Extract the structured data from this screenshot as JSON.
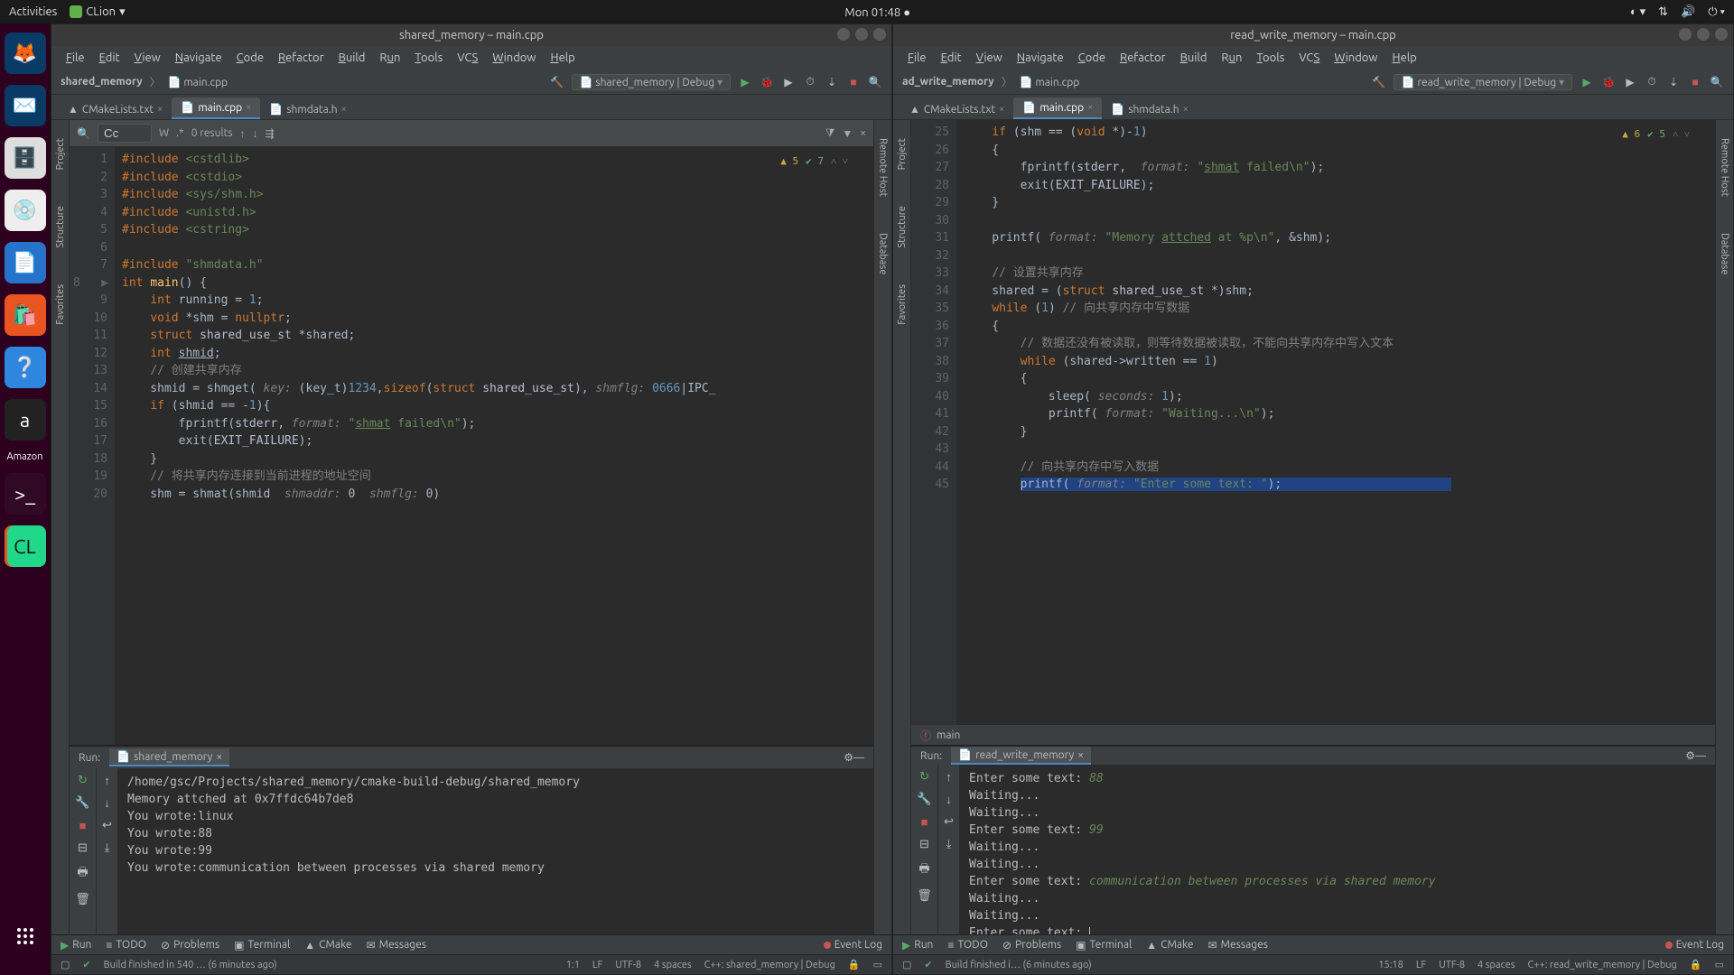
{
  "gnome": {
    "activities": "Activities",
    "app": "CLion",
    "clock": "Mon 01:48"
  },
  "dock": {
    "amazon_label": "Amazon"
  },
  "left_window": {
    "title": "shared_memory – main.cpp",
    "menus": [
      "File",
      "Edit",
      "View",
      "Navigate",
      "Code",
      "Refactor",
      "Build",
      "Run",
      "Tools",
      "VCS",
      "Window",
      "Help"
    ],
    "crumb_project": "shared_memory",
    "crumb_file": "main.cpp",
    "config": "shared_memory | Debug",
    "tabs": [
      {
        "name": "CMakeLists.txt",
        "active": false
      },
      {
        "name": "main.cpp",
        "active": true
      },
      {
        "name": "shmdata.h",
        "active": false
      }
    ],
    "find_results": "0 results",
    "hints": {
      "warn": "5",
      "check": "7"
    },
    "code_lines": [
      "1",
      "2",
      "3",
      "4",
      "5",
      "6",
      "7",
      "8",
      "9",
      "10",
      "11",
      "12",
      "13",
      "14",
      "15",
      "16",
      "17",
      "18",
      "19",
      "20"
    ],
    "run": {
      "label": "Run:",
      "config": "shared_memory",
      "output": [
        {
          "t": "/home/gsc/Projects/shared_memory/cmake-build-debug/shared_memory"
        },
        {
          "t": "Memory attched at 0x7ffdc64b7de8"
        },
        {
          "t": "You wrote:linux"
        },
        {
          "t": "You wrote:88"
        },
        {
          "t": "You wrote:99"
        },
        {
          "t": "You wrote:communication between processes via shared memory"
        }
      ]
    },
    "toolstrip": {
      "run": "Run",
      "todo": "TODO",
      "problems": "Problems",
      "terminal": "Terminal",
      "cmake": "CMake",
      "messages": "Messages",
      "eventlog": "Event Log"
    },
    "status": {
      "build": "Build finished in 540 … (6 minutes ago)",
      "pos": "1:1",
      "enc": "LF",
      "charset": "UTF-8",
      "indent": "4 spaces",
      "ctx": "C++: shared_memory | Debug"
    }
  },
  "right_window": {
    "title": "read_write_memory – main.cpp",
    "menus": [
      "File",
      "Edit",
      "View",
      "Navigate",
      "Code",
      "Refactor",
      "Build",
      "Run",
      "Tools",
      "VCS",
      "Window",
      "Help"
    ],
    "crumb_project": "ad_write_memory",
    "crumb_file": "main.cpp",
    "config": "read_write_memory | Debug",
    "tabs": [
      {
        "name": "CMakeLists.txt",
        "active": false
      },
      {
        "name": "main.cpp",
        "active": true
      },
      {
        "name": "shmdata.h",
        "active": false
      }
    ],
    "hints": {
      "warn": "6",
      "check": "5"
    },
    "code_lines": [
      "25",
      "26",
      "27",
      "28",
      "29",
      "30",
      "31",
      "32",
      "33",
      "34",
      "35",
      "36",
      "37",
      "38",
      "39",
      "40",
      "41",
      "42",
      "43",
      "44",
      "45"
    ],
    "breadcrumb_fn": "main",
    "run": {
      "label": "Run:",
      "config": "read_write_memory",
      "output": [
        {
          "t": "Enter some text: ",
          "in": "88"
        },
        {
          "t": "Waiting..."
        },
        {
          "t": "Waiting..."
        },
        {
          "t": "Enter some text: ",
          "in": "99"
        },
        {
          "t": "Waiting..."
        },
        {
          "t": "Waiting..."
        },
        {
          "t": "Enter some text: ",
          "in": "communication between processes via shared memory"
        },
        {
          "t": "Waiting..."
        },
        {
          "t": "Waiting..."
        },
        {
          "t": "Enter some text: "
        }
      ]
    },
    "toolstrip": {
      "run": "Run",
      "todo": "TODO",
      "problems": "Problems",
      "terminal": "Terminal",
      "cmake": "CMake",
      "messages": "Messages",
      "eventlog": "Event Log"
    },
    "status": {
      "build": "Build finished i… (6 minutes ago)",
      "pos": "15:18",
      "enc": "LF",
      "charset": "UTF-8",
      "indent": "4 spaces",
      "ctx": "C++: read_write_memory | Debug"
    }
  }
}
